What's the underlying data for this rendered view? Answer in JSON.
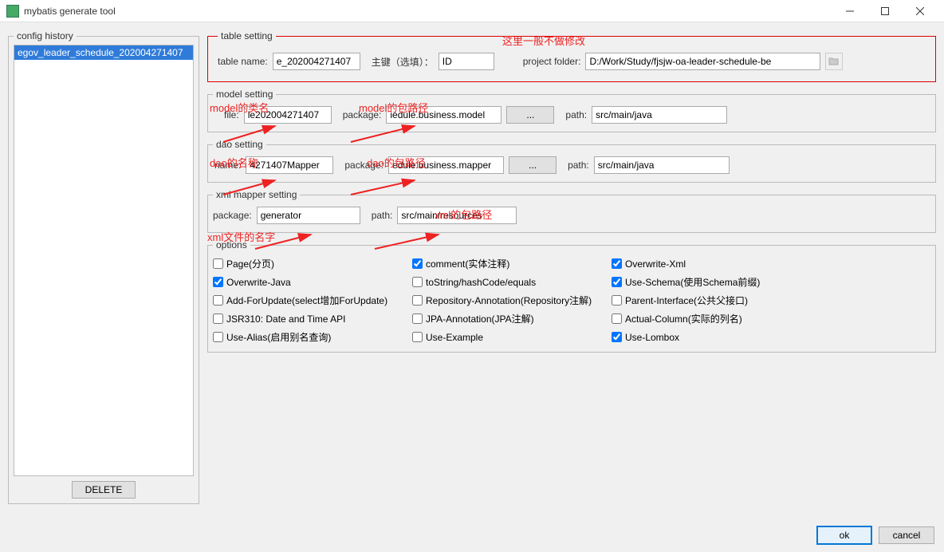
{
  "window": {
    "title": "mybatis generate tool"
  },
  "sidebar": {
    "legend": "config history",
    "items": [
      "egov_leader_schedule_202004271407"
    ],
    "delete_label": "DELETE"
  },
  "table_setting": {
    "legend": "table setting",
    "table_name_label": "table name:",
    "table_name_value": "e_202004271407",
    "pk_label": "主键（选填）：",
    "pk_value": "ID",
    "project_folder_label": "project folder:",
    "project_folder_value": "D:/Work/Study/fjsjw-oa-leader-schedule-be",
    "note": "这里一般不做修改"
  },
  "model_setting": {
    "legend": "model setting",
    "file_label": "file:",
    "file_value": "le202004271407",
    "package_label": "package:",
    "package_value": "iedule.business.model",
    "browse": "...",
    "path_label": "path:",
    "path_value": "src/main/java",
    "note_class": "model的类名",
    "note_pkg": "model的包路径"
  },
  "dao_setting": {
    "legend": "dao setting",
    "name_label": "name:",
    "name_value": "4271407Mapper",
    "package_label": "package:",
    "package_value": "edule.business.mapper",
    "browse": "...",
    "path_label": "path:",
    "path_value": "src/main/java",
    "note_name": "dao的名称",
    "note_pkg": "dao的包路径"
  },
  "xml_setting": {
    "legend": "xml mapper setting",
    "package_label": "package:",
    "package_value": "generator",
    "path_label": "path:",
    "path_value": "src/main/resources",
    "note_file": "xml文件的名字",
    "note_pkg": "xml的包路径"
  },
  "options": {
    "legend": "options",
    "items": [
      {
        "label": "Page(分页)",
        "checked": false
      },
      {
        "label": "comment(实体注释)",
        "checked": true
      },
      {
        "label": "Overwrite-Xml",
        "checked": true
      },
      {
        "label": "Overwrite-Java",
        "checked": true
      },
      {
        "label": "toString/hashCode/equals",
        "checked": false
      },
      {
        "label": "Use-Schema(使用Schema前缀)",
        "checked": true
      },
      {
        "label": "Add-ForUpdate(select增加ForUpdate)",
        "checked": false
      },
      {
        "label": "Repository-Annotation(Repository注解)",
        "checked": false
      },
      {
        "label": "Parent-Interface(公共父接口)",
        "checked": false
      },
      {
        "label": "JSR310: Date and Time API",
        "checked": false
      },
      {
        "label": "JPA-Annotation(JPA注解)",
        "checked": false
      },
      {
        "label": "Actual-Column(实际的列名)",
        "checked": false
      },
      {
        "label": "Use-Alias(启用别名查询)",
        "checked": false
      },
      {
        "label": "Use-Example",
        "checked": false
      },
      {
        "label": "Use-Lombox",
        "checked": true
      }
    ]
  },
  "footer": {
    "ok": "ok",
    "cancel": "cancel"
  }
}
